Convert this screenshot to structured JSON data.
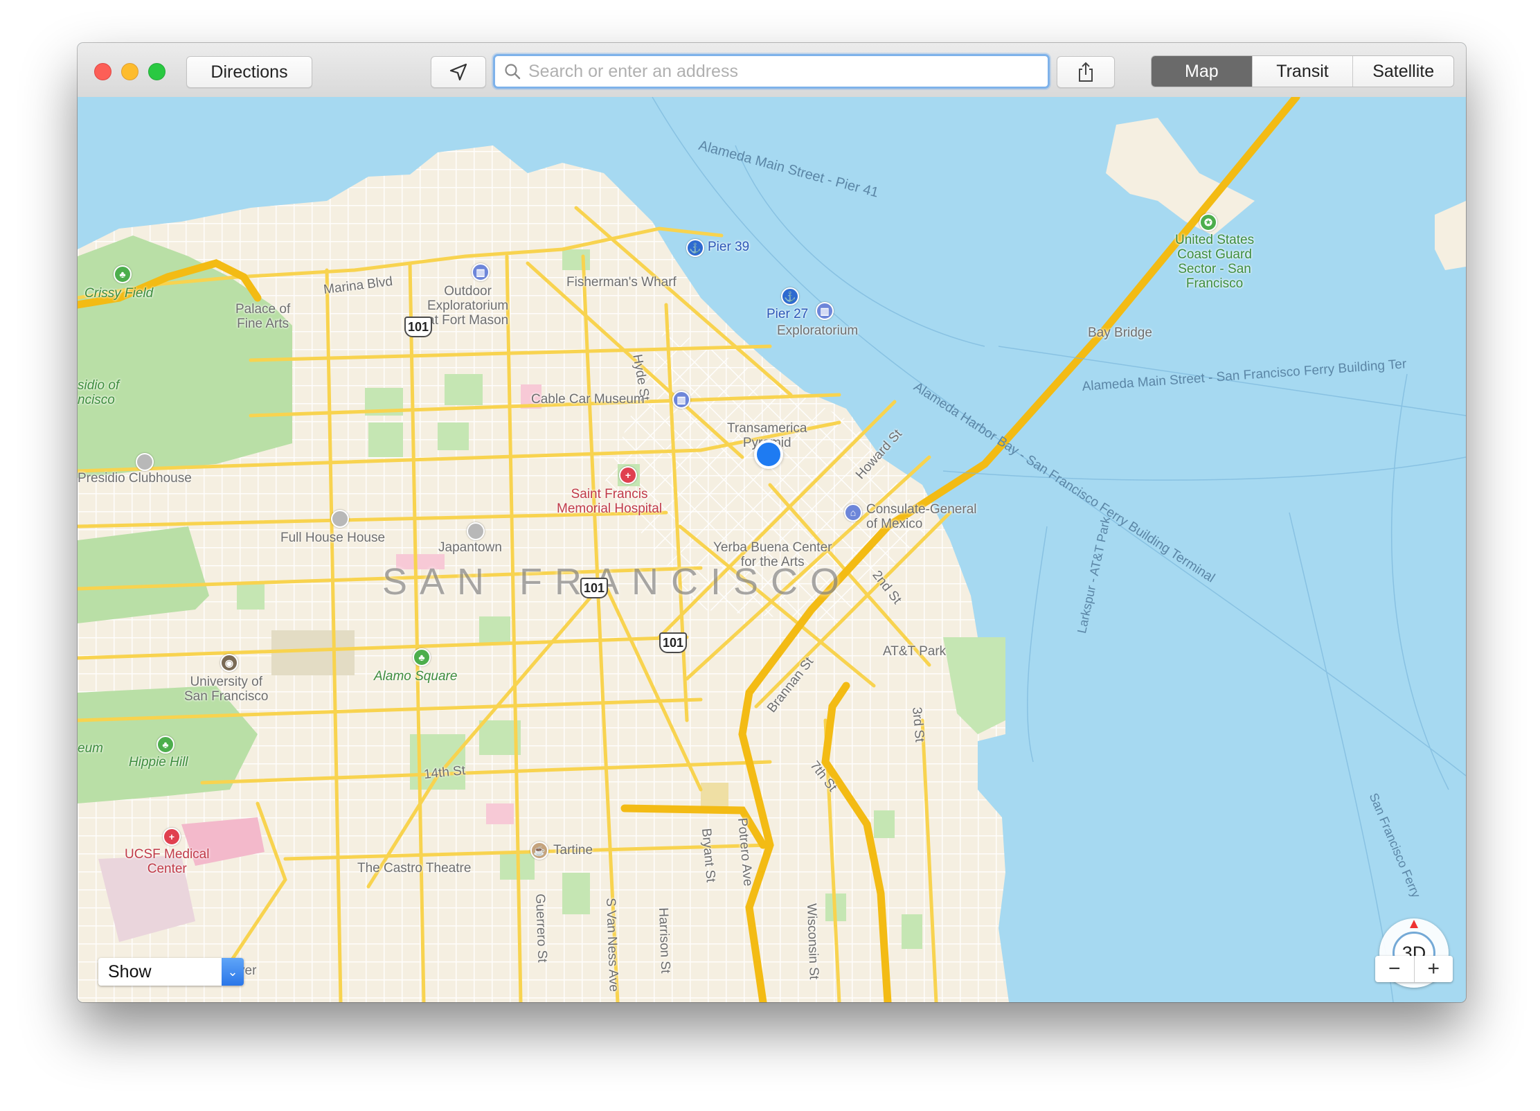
{
  "window": {
    "toolbar": {
      "directions_label": "Directions",
      "search_placeholder": "Search or enter an address",
      "view_modes": [
        {
          "label": "Map",
          "active": true
        },
        {
          "label": "Transit",
          "active": false
        },
        {
          "label": "Satellite",
          "active": false
        }
      ]
    },
    "map": {
      "city_label": "SAN FRANCISCO",
      "places": {
        "pier39": "Pier 39",
        "pier27": "Pier 27",
        "fishermans_wharf": "Fisherman's Wharf",
        "outdoor_exploratorium": "Outdoor\nExploratorium\nat Fort Mason",
        "marina_blvd": "Marina Blvd",
        "crissy_field": "Crissy Field",
        "palace_fine_arts": "Palace of\nFine Arts",
        "presidio": "sidio of\nncisco",
        "presidio_clubhouse": "Presidio Clubhouse",
        "hyde_st": "Hyde St",
        "exploratorium": "Exploratorium",
        "cable_car_museum": "Cable Car Museum",
        "transamerica": "Transamerica\nPyramid",
        "saint_francis": "Saint Francis\nMemorial Hospital",
        "howard_st": "Howard St",
        "consulate": "Consulate-General\nof Mexico",
        "full_house": "Full House House",
        "japantown": "Japantown",
        "yerba_buena": "Yerba Buena Center\nfor the Arts",
        "second_st": "2nd St",
        "att_park": "AT&T Park",
        "university_sf": "University of\nSan Francisco",
        "alamo_square": "Alamo Square",
        "brannan_st": "Brannan St",
        "third_st": "3rd St",
        "seventh_st": "7th St",
        "museum_partial": "eum",
        "hippie_hill": "Hippie Hill",
        "fourteenth_st": "14th St",
        "ucsf": "UCSF Medical\nCenter",
        "castro_theatre": "The Castro Theatre",
        "tartine": "Tartine",
        "bryant_st": "Bryant St",
        "potrero_ave": "Potrero Ave",
        "guerrero_st": "Guerrero St",
        "svanness": "S Van Ness Ave",
        "harrison_st": "Harrison St",
        "wisconsin_st": "Wisconsin St",
        "river_partial": "ver",
        "coast_guard": "United States\nCoast Guard\nSector - San\nFrancisco",
        "bay_bridge": "Bay Bridge"
      },
      "water_labels": {
        "ferry_pier41": "Alameda Main Street - Pier 41",
        "ferry_sf_building": "Alameda Main Street - San Francisco Ferry Building Ter",
        "harbor_bay": "Alameda Harbor Bay - San Francisco Ferry Building Terminal",
        "larkspur": "Larkspur - AT&T Park",
        "sf_ferry": "San Francisco Ferry"
      },
      "highway_shields": [
        "101",
        "101",
        "101"
      ]
    },
    "show_select": {
      "value": "Show"
    },
    "compass_label": "3D",
    "zoom": {
      "minus": "−",
      "plus": "+"
    }
  }
}
